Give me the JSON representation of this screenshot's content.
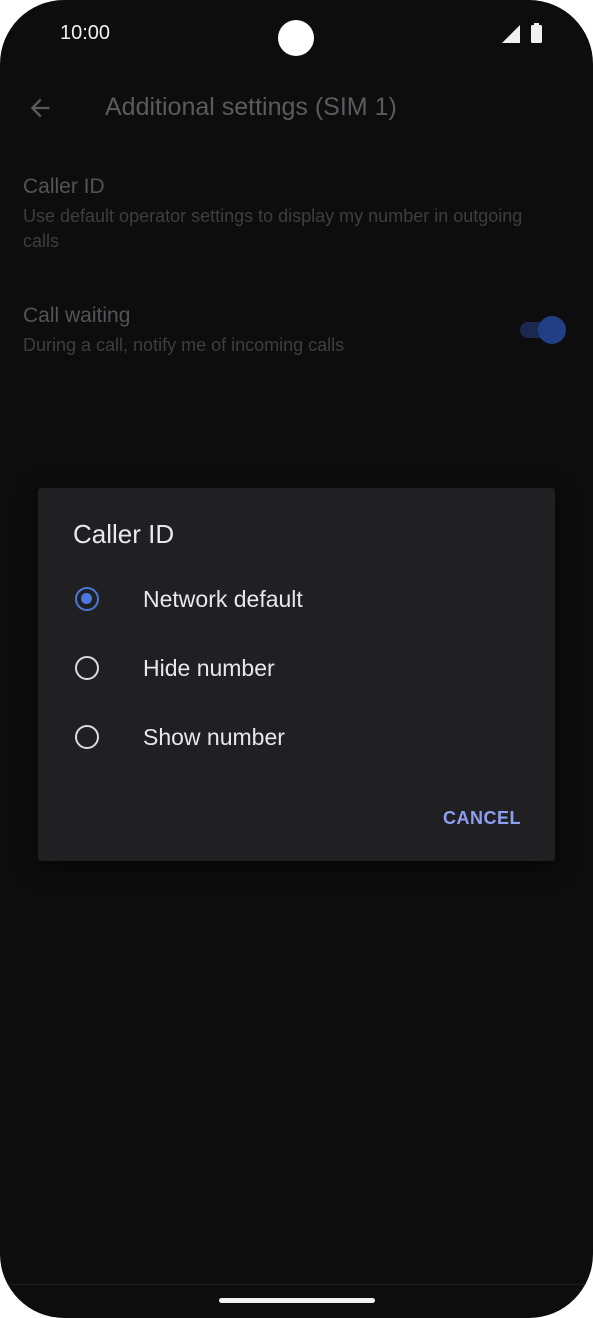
{
  "status_bar": {
    "time": "10:00"
  },
  "app_bar": {
    "title": "Additional settings (SIM 1)",
    "back_icon": "arrow-left-icon"
  },
  "settings": [
    {
      "title": "Caller ID",
      "summary": "Use default operator settings to display my number in outgoing calls"
    },
    {
      "title": "Call waiting",
      "summary": "During a call, notify me of incoming calls",
      "toggle_on": true
    }
  ],
  "dialog": {
    "title": "Caller ID",
    "options": [
      {
        "label": "Network default",
        "selected": true
      },
      {
        "label": "Hide number",
        "selected": false
      },
      {
        "label": "Show number",
        "selected": false
      }
    ],
    "cancel_label": "CANCEL"
  },
  "colors": {
    "accent": "#4a77e0",
    "button_text": "#8e9ef1",
    "dialog_bg": "#202022",
    "screen_bg": "#0d0d0e"
  }
}
